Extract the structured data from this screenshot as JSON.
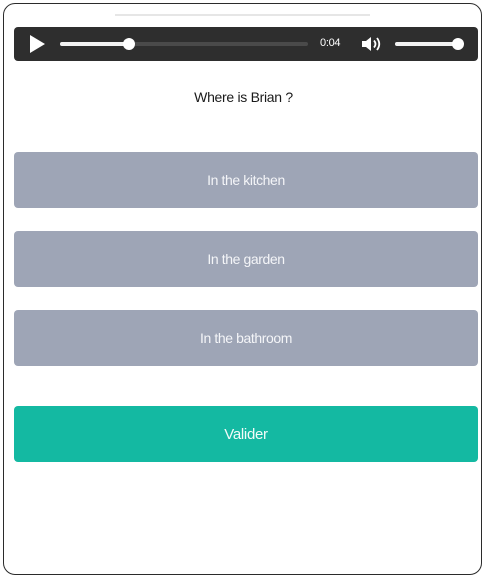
{
  "player": {
    "time": "0:04",
    "progress": 0.28,
    "volume": 0.95,
    "icons": {
      "play": "play-icon",
      "volume": "speaker-volume-icon"
    },
    "colors": {
      "background": "#2e2e2e",
      "track": "#4a4a4a",
      "fill": "#f2f2f2"
    }
  },
  "quiz": {
    "question": "Where is Brian ?",
    "answers": [
      "In the kitchen",
      "In the garden",
      "In the bathroom"
    ],
    "submit_label": "Valider"
  },
  "colors": {
    "answer": "#9ea5b6",
    "submit": "#14b9a2"
  }
}
